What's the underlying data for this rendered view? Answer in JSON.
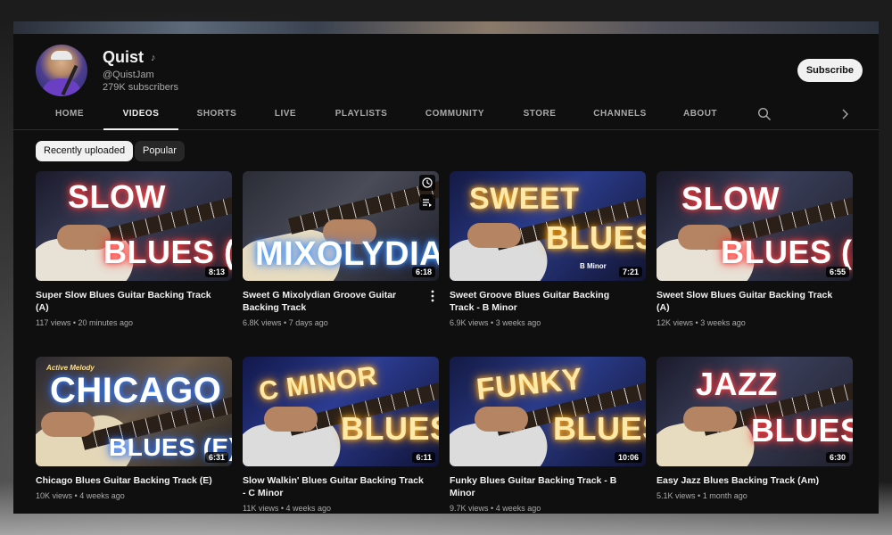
{
  "channel": {
    "name": "Quist",
    "handle": "@QuistJam",
    "subscribers": "279K subscribers",
    "subscribe_label": "Subscribe"
  },
  "tabs": [
    {
      "label": "HOME",
      "active": false
    },
    {
      "label": "VIDEOS",
      "active": true
    },
    {
      "label": "SHORTS",
      "active": false
    },
    {
      "label": "LIVE",
      "active": false
    },
    {
      "label": "PLAYLISTS",
      "active": false
    },
    {
      "label": "COMMUNITY",
      "active": false
    },
    {
      "label": "STORE",
      "active": false
    },
    {
      "label": "CHANNELS",
      "active": false
    },
    {
      "label": "ABOUT",
      "active": false
    }
  ],
  "chips": [
    {
      "label": "Recently uploaded",
      "active": true
    },
    {
      "label": "Popular",
      "active": false
    }
  ],
  "videos": [
    {
      "title": "Super Slow Blues Guitar Backing Track (A)",
      "views": "117 views",
      "age": "20 minutes ago",
      "duration": "8:13",
      "thumb_top": "SLOW",
      "thumb_bottom": "BLUES (A)",
      "thumb_tag": ""
    },
    {
      "title": "Sweet G Mixolydian Groove Guitar Backing Track",
      "views": "6.8K views",
      "age": "7 days ago",
      "duration": "6:18",
      "thumb_top": "",
      "thumb_bottom": "MIXOLYDIAN",
      "thumb_tag": ""
    },
    {
      "title": "Sweet Groove Blues Guitar Backing Track - B Minor",
      "views": "6.9K views",
      "age": "3 weeks ago",
      "duration": "7:21",
      "thumb_top": "SWEET",
      "thumb_bottom": "BLUES",
      "thumb_tag": "B Minor"
    },
    {
      "title": "Sweet Slow Blues Guitar Backing Track (A)",
      "views": "12K views",
      "age": "3 weeks ago",
      "duration": "6:55",
      "thumb_top": "SLOW",
      "thumb_bottom": "BLUES (A)",
      "thumb_tag": ""
    },
    {
      "title": "Chicago Blues Guitar Backing Track (E)",
      "views": "10K views",
      "age": "4 weeks ago",
      "duration": "6:31",
      "thumb_top": "CHICAGO",
      "thumb_bottom": "BLUES (E)",
      "thumb_tag": "Active Melody"
    },
    {
      "title": "Slow Walkin' Blues Guitar Backing Track - C Minor",
      "views": "11K views",
      "age": "4 weeks ago",
      "duration": "6:11",
      "thumb_top": "C MINOR",
      "thumb_bottom": "BLUES",
      "thumb_tag": ""
    },
    {
      "title": "Funky Blues Guitar Backing Track - B Minor",
      "views": "9.7K views",
      "age": "4 weeks ago",
      "duration": "10:06",
      "thumb_top": "FUNKY",
      "thumb_bottom": "BLUES",
      "thumb_tag": ""
    },
    {
      "title": "Easy Jazz Blues Backing Track (Am)",
      "views": "5.1K views",
      "age": "1 month ago",
      "duration": "6:30",
      "thumb_top": "JAZZ",
      "thumb_bottom": "BLUES",
      "thumb_tag": ""
    }
  ],
  "icons": {
    "search": "search-icon",
    "next": "chevron-right-icon",
    "music_note": "music-note-icon",
    "watch_later": "clock-icon",
    "add_queue": "add-to-queue-icon",
    "more": "more-vert-icon"
  },
  "colors": {
    "background": "#0f0f0f",
    "text": "#f1f1f1",
    "secondary_text": "#aaaaaa",
    "chip_active": "#f1f1f1",
    "chip_inactive": "#272727",
    "neon_red": "#ff5a5a",
    "neon_white": "#ffffff",
    "neon_yellow": "#ffd24a"
  }
}
